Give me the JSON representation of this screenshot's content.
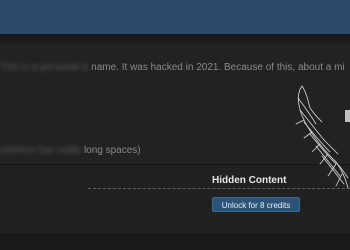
{
  "post": {
    "line1_blurred": "This is a personal is",
    "line1_visible": "name. It was hacked in 2021. Because of this, about a mi",
    "line2_blurred": "whether has really",
    "line2_visible": "long spaces)"
  },
  "hidden_content": {
    "title": "Hidden Content",
    "button_label": "Unlock for 8 credits"
  }
}
